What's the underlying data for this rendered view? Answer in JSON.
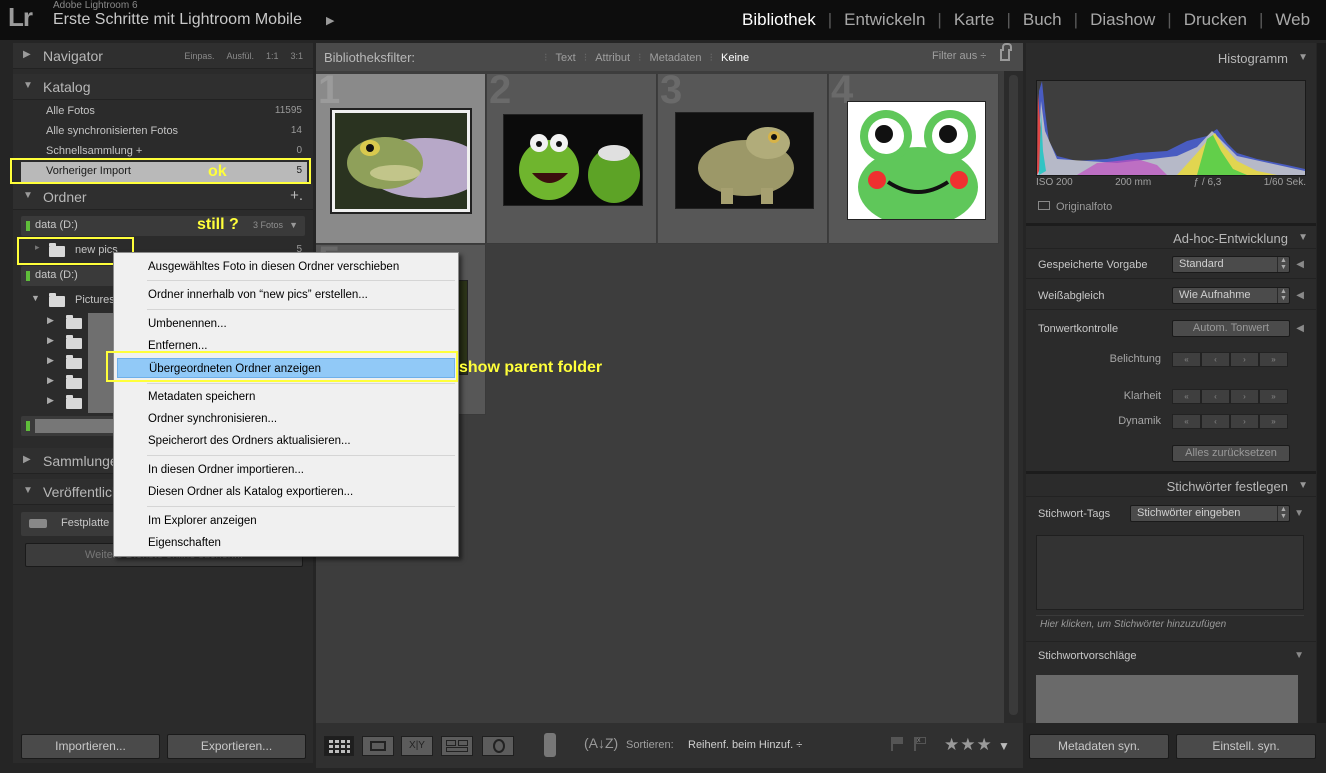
{
  "topbar": {
    "logo": "Lr",
    "app_name": "Adobe Lightroom 6",
    "catalog_title": "Erste Schritte mit Lightroom Mobile",
    "catalog_arrow": "▶",
    "modules": [
      "Bibliothek",
      "Entwickeln",
      "Karte",
      "Buch",
      "Diashow",
      "Drucken",
      "Web"
    ],
    "active_module": "Bibliothek"
  },
  "left": {
    "navigator": {
      "title": "Navigator",
      "zoom": [
        "Einpas.",
        "Ausfül.",
        "1:1",
        "3:1"
      ]
    },
    "katalog": {
      "title": "Katalog",
      "items": [
        {
          "label": "Alle Fotos",
          "count": "11595"
        },
        {
          "label": "Alle synchronisierten Fotos",
          "count": "14"
        },
        {
          "label": "Schnellsammlung +",
          "count": "0"
        },
        {
          "label": "Vorheriger Import",
          "count": "5"
        }
      ]
    },
    "ordner": {
      "title": "Ordner",
      "add": "+.",
      "volume1": {
        "label": "data (D:)",
        "count": "3 Fotos"
      },
      "folder_newpics": {
        "label": "new pics",
        "count": "5"
      },
      "volume2": {
        "label": "data (D:)"
      },
      "folder_pictures": "Pictures"
    },
    "sammlungen": {
      "title": "Sammlungen"
    },
    "veroeffentlich": {
      "title": "Veröffentlichungsdienste",
      "festplatte": "Festplatte",
      "weitere": "Weitere Dienste online suchen..."
    },
    "import_btn": "Importieren...",
    "export_btn": "Exportieren..."
  },
  "annotations": {
    "ok": "ok",
    "still": "still ?",
    "show_parent": "show parent folder"
  },
  "filterbar": {
    "label": "Bibliotheksfilter:",
    "options": [
      "Text",
      "Attribut",
      "Metadaten",
      "Keine"
    ],
    "active": "Keine",
    "filter_off": "Filter aus ÷"
  },
  "grid": {
    "numbers": [
      "1",
      "2",
      "3",
      "4",
      "5"
    ]
  },
  "toolbar": {
    "sort_label": "Sortieren:",
    "sort_value": "Reihenf. beim Hinzuf.  ÷",
    "stars": "★★★"
  },
  "context_menu": {
    "items": [
      "Ausgewähltes Foto in diesen Ordner verschieben",
      "Ordner innerhalb von “new pics” erstellen...",
      "Umbenennen...",
      "Entfernen...",
      "Übergeordneten Ordner anzeigen",
      "Metadaten speichern",
      "Ordner synchronisieren...",
      "Speicherort des Ordners aktualisieren...",
      "In diesen Ordner importieren...",
      "Diesen Ordner als Katalog exportieren...",
      "Im Explorer anzeigen",
      "Eigenschaften"
    ],
    "highlighted": "Übergeordneten Ordner anzeigen"
  },
  "right": {
    "histogram": {
      "title": "Histogramm",
      "iso": "ISO 200",
      "focal": "200 mm",
      "aperture": "ƒ / 6,3",
      "shutter": "1/60 Sek.",
      "original": "Originalfoto"
    },
    "adhoc": {
      "title": "Ad-hoc-Entwicklung",
      "preset_label": "Gespeicherte Vorgabe",
      "preset_value": "Standard",
      "wb_label": "Weißabgleich",
      "wb_value": "Wie Aufnahme",
      "tone_label": "Tonwertkontrolle",
      "tone_btn": "Autom. Tonwert",
      "belichtung": "Belichtung",
      "klarheit": "Klarheit",
      "dynamik": "Dynamik",
      "reset": "Alles zurücksetzen"
    },
    "keywords": {
      "title": "Stichwörter festlegen",
      "tags_label": "Stichwort-Tags",
      "tags_value": "Stichwörter eingeben",
      "hint": "Hier klicken, um Stichwörter hinzuzufügen",
      "suggestions": "Stichwortvorschläge"
    },
    "metadata_sync": "Metadaten syn.",
    "settings_sync": "Einstell. syn."
  },
  "colors": {
    "accent_annotation": "#ffff3a",
    "menu_highlight": "#91c9f7",
    "led": "#5fbd3a"
  }
}
